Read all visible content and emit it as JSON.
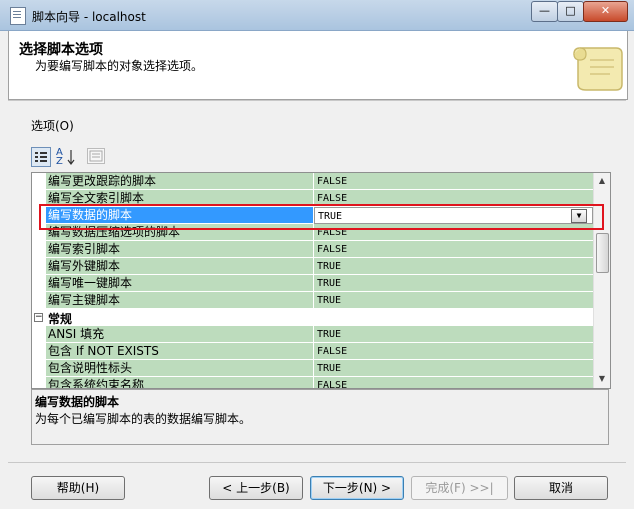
{
  "window": {
    "title": "脚本向导 - localhost",
    "minimize": "—",
    "maximize": "□",
    "close": "✕"
  },
  "header": {
    "title": "选择脚本选项",
    "subtitle": "为要编写脚本的对象选择选项。"
  },
  "options_label": "选项(O)",
  "toolbar": {
    "sort_glyph": "A↓Z"
  },
  "grid": {
    "rows": [
      {
        "name": "编写更改跟踪的脚本",
        "value": "FALSE"
      },
      {
        "name": "编写全文索引脚本",
        "value": "FALSE"
      },
      {
        "name": "编写数据的脚本",
        "value": "TRUE",
        "selected": true
      },
      {
        "name": "编写数据压缩选项的脚本",
        "value": "FALSE"
      },
      {
        "name": "编写索引脚本",
        "value": "FALSE"
      },
      {
        "name": "编写外键脚本",
        "value": "TRUE"
      },
      {
        "name": "编写唯一键脚本",
        "value": "TRUE"
      },
      {
        "name": "编写主键脚本",
        "value": "TRUE"
      }
    ],
    "category": {
      "toggle": "−",
      "name": "常规"
    },
    "general_rows": [
      {
        "name": "ANSI 填充",
        "value": "TRUE"
      },
      {
        "name": "包含 If NOT EXISTS",
        "value": "FALSE"
      },
      {
        "name": "包含说明性标头",
        "value": "TRUE"
      },
      {
        "name": "包含系统约束名称",
        "value": "FALSE"
      }
    ],
    "dropdown_glyph": "▼",
    "scroll_up": "▲",
    "scroll_down": "▼"
  },
  "description": {
    "title": "编写数据的脚本",
    "text": "为每个已编写脚本的表的数据编写脚本。"
  },
  "buttons": {
    "help": "帮助(H)",
    "back": "< 上一步(B)",
    "next": "下一步(N) >",
    "finish": "完成(F) >>|",
    "cancel": "取消"
  },
  "colors": {
    "row_green": "#bddcbd",
    "selection_blue": "#3399ff",
    "highlight_red": "#e0141e"
  }
}
